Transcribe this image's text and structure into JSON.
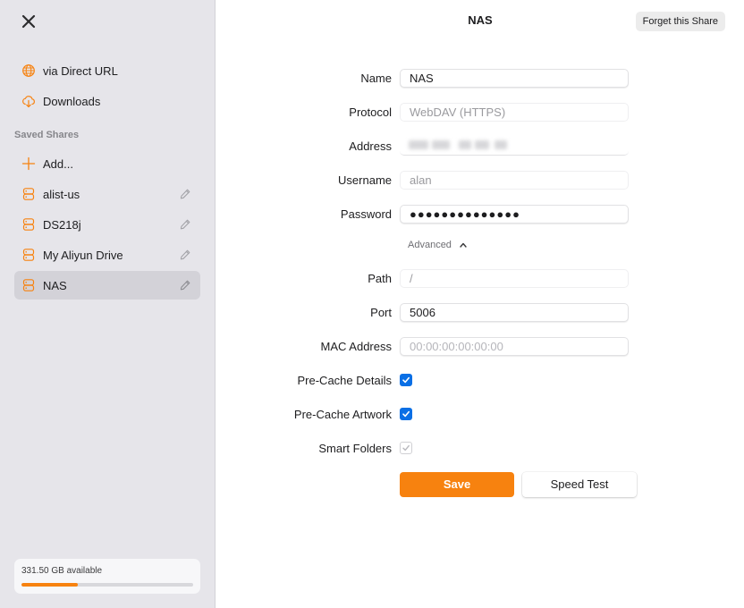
{
  "colors": {
    "accent": "#f7820f",
    "checkbox": "#0a6fe5",
    "sidebar_bg": "#e6e5ea"
  },
  "sidebar": {
    "close_icon": "close-icon",
    "top_items": [
      {
        "label": "via Direct URL",
        "icon": "globe-icon"
      },
      {
        "label": "Downloads",
        "icon": "cloud-download-icon"
      }
    ],
    "section_title": "Saved Shares",
    "add_label": "Add...",
    "shares": [
      {
        "label": "alist-us",
        "icon": "server-icon"
      },
      {
        "label": "DS218j",
        "icon": "server-icon"
      },
      {
        "label": "My Aliyun Drive",
        "icon": "server-icon"
      },
      {
        "label": "NAS",
        "icon": "server-icon",
        "selected": true
      }
    ],
    "storage": {
      "text": "331.50 GB available",
      "used_fraction": 0.33
    }
  },
  "header": {
    "title": "NAS",
    "forget_label": "Forget this Share"
  },
  "form": {
    "name": {
      "label": "Name",
      "value": "NAS"
    },
    "protocol": {
      "label": "Protocol",
      "value": "WebDAV (HTTPS)"
    },
    "address": {
      "label": "Address"
    },
    "username": {
      "label": "Username",
      "value": "alan"
    },
    "password": {
      "label": "Password",
      "value": "●●●●●●●●●●●●●●"
    },
    "advanced_label": "Advanced",
    "path": {
      "label": "Path",
      "value": "/"
    },
    "port": {
      "label": "Port",
      "value": "5006"
    },
    "mac": {
      "label": "MAC Address",
      "placeholder": "00:00:00:00:00:00"
    },
    "precache_details": {
      "label": "Pre-Cache Details",
      "checked": true
    },
    "precache_artwork": {
      "label": "Pre-Cache Artwork",
      "checked": true
    },
    "smart_folders": {
      "label": "Smart Folders",
      "checked": true,
      "disabled": true
    },
    "save_label": "Save",
    "speed_test_label": "Speed Test"
  }
}
